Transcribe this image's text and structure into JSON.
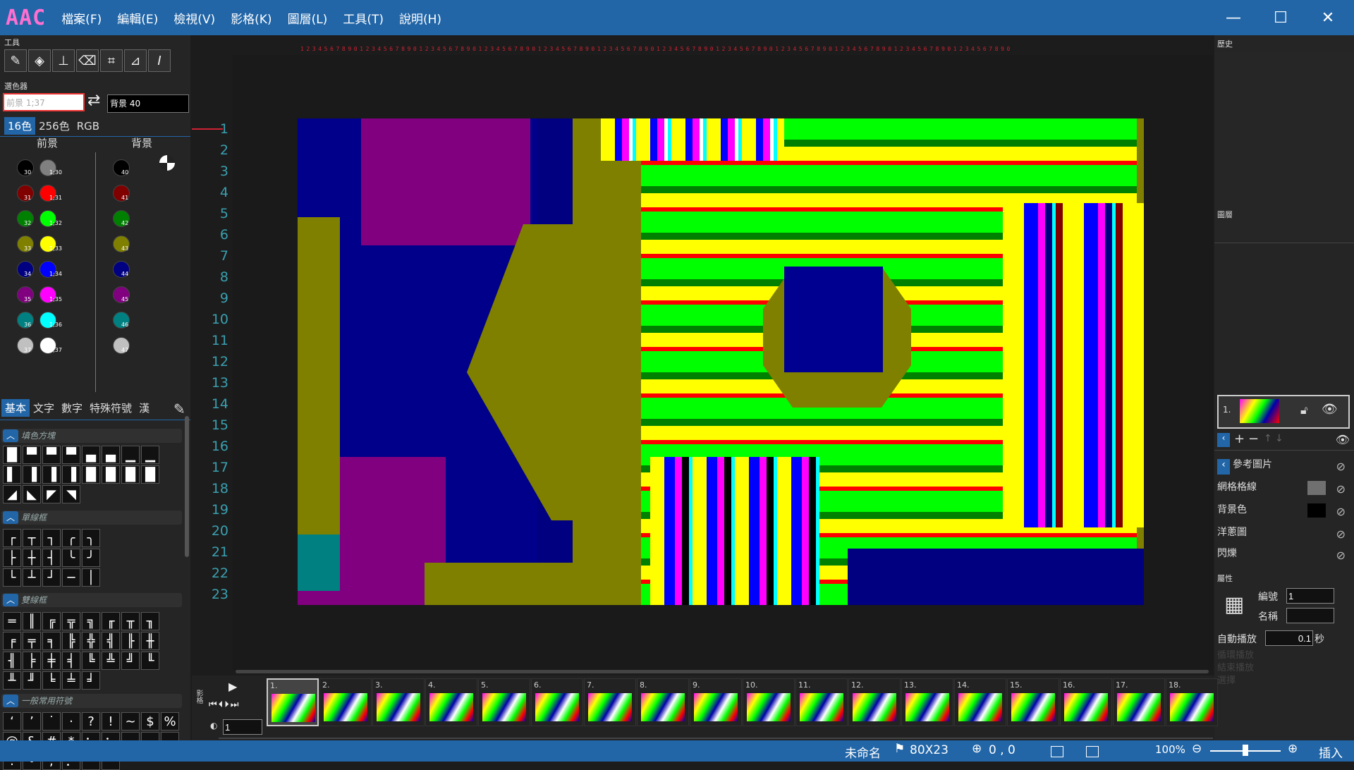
{
  "app": {
    "logo": "AAC"
  },
  "menu": [
    "檔案(F)",
    "編輯(E)",
    "檢視(V)",
    "影格(K)",
    "圖層(L)",
    "工具(T)",
    "說明(H)"
  ],
  "window_controls": {
    "minimize": "—",
    "maximize": "☐",
    "close": "✕"
  },
  "tools_panel": {
    "title": "工具",
    "icons": [
      "brush-icon",
      "fill-bucket-icon",
      "stamp-icon",
      "eraser-icon",
      "select-rect-icon",
      "select-lasso-icon",
      "text-cursor-icon"
    ]
  },
  "color_picker": {
    "title": "選色器",
    "fg_field": "前景 1;37",
    "swap": "⇄",
    "bg_field": "背景 40",
    "modes": [
      "16色",
      "256色",
      "RGB"
    ],
    "fg_label": "前景",
    "bg_label": "背景",
    "fg_swatches": [
      {
        "a": "30",
        "b": "1;30",
        "ca": "#000000",
        "cb": "#808080"
      },
      {
        "a": "31",
        "b": "1;31",
        "ca": "#800000",
        "cb": "#ff0000"
      },
      {
        "a": "32",
        "b": "1;32",
        "ca": "#008000",
        "cb": "#00ff00"
      },
      {
        "a": "33",
        "b": "1;33",
        "ca": "#808000",
        "cb": "#ffff00"
      },
      {
        "a": "34",
        "b": "1;34",
        "ca": "#000080",
        "cb": "#0000ff"
      },
      {
        "a": "35",
        "b": "1;35",
        "ca": "#800080",
        "cb": "#ff00ff"
      },
      {
        "a": "36",
        "b": "1;36",
        "ca": "#008080",
        "cb": "#00ffff"
      },
      {
        "a": "37",
        "b": "1;37",
        "ca": "#c0c0c0",
        "cb": "#ffffff"
      }
    ],
    "bg_swatches": [
      {
        "n": "40",
        "c": "#000000"
      },
      {
        "n": "41",
        "c": "#800000"
      },
      {
        "n": "42",
        "c": "#008000"
      },
      {
        "n": "43",
        "c": "#808000"
      },
      {
        "n": "44",
        "c": "#000080"
      },
      {
        "n": "45",
        "c": "#800080"
      },
      {
        "n": "46",
        "c": "#008080"
      },
      {
        "n": "47",
        "c": "#c0c0c0"
      }
    ]
  },
  "char_tabs": [
    "基本",
    "文字",
    "數字",
    "特殊符號",
    "漢"
  ],
  "sections": {
    "fill": "填色方塊",
    "single": "單線框",
    "double": "雙線框",
    "common": "一般常用符號"
  },
  "fill_blocks": [
    "█",
    "▀",
    "▀",
    "▀",
    "▄",
    "▄",
    "▁",
    "▁",
    "▌",
    "▐",
    "▐",
    "▐",
    "█",
    "█",
    "█",
    "█",
    "◢",
    "◣",
    "◤",
    "◥"
  ],
  "single_box": [
    "┌",
    "┬",
    "┐",
    "╭",
    "╮",
    "├",
    "┼",
    "┤",
    "╰",
    "╯",
    "└",
    "┴",
    "┘",
    "─",
    "│"
  ],
  "double_box": [
    "═",
    "║",
    "╔",
    "╦",
    "╗",
    "╓",
    "╥",
    "╖",
    "╒",
    "╤",
    "╕",
    "╠",
    "╬",
    "╣",
    "╟",
    "╫",
    "╢",
    "╞",
    "╪",
    "╡",
    "╚",
    "╩",
    "╝",
    "╙",
    "╨",
    "╜",
    "╘",
    "╧",
    "╛"
  ],
  "common_symbols": [
    "‘",
    "’",
    "˙",
    "·",
    "?",
    "!",
    "∼",
    "$",
    "%",
    "@",
    "&",
    "#",
    "*",
    "：",
    "：",
    "…",
    "‥",
    ",",
    ".",
    "•",
    ";",
    "：",
    "\"",
    "“"
  ],
  "ruler_digits": "1234567890",
  "row_numbers": [
    "1",
    "2",
    "3",
    "4",
    "5",
    "6",
    "7",
    "8",
    "9",
    "10",
    "11",
    "12",
    "13",
    "14",
    "15",
    "16",
    "17",
    "18",
    "19",
    "20",
    "21",
    "22",
    "23"
  ],
  "history": {
    "title": "歷史"
  },
  "layers": {
    "title": "圖層",
    "layer1_num": "1.",
    "ref_image": "參考圖片",
    "grid": "網格格線",
    "bg_color": "背景色",
    "onion": "洋蔥圖",
    "blink": "閃爍",
    "grid_color": "#707070",
    "bg_color_value": "#000000"
  },
  "properties": {
    "title": "屬性",
    "id_label": "編號",
    "id_value": "1",
    "name_label": "名稱",
    "name_value": "",
    "autoplay_label": "自動播放",
    "autoplay_value": "0.1",
    "autoplay_unit": "秒",
    "disabled1": "循環播放",
    "disabled2": "結束播放",
    "disabled3": "選擇"
  },
  "timeline": {
    "side_label": "影格",
    "frame_input": "1",
    "frames": [
      "1.",
      "2.",
      "3.",
      "4.",
      "5.",
      "6.",
      "7.",
      "8.",
      "9.",
      "10.",
      "11.",
      "12.",
      "13.",
      "14.",
      "15.",
      "16.",
      "17.",
      "18."
    ]
  },
  "status": {
    "filename": "未命名",
    "size": "80X23",
    "pos": "0 , 0",
    "zoom": "100%",
    "mode": "插入"
  },
  "colors": {
    "accent": "#2266a8",
    "logo": "#ff6fd0"
  }
}
